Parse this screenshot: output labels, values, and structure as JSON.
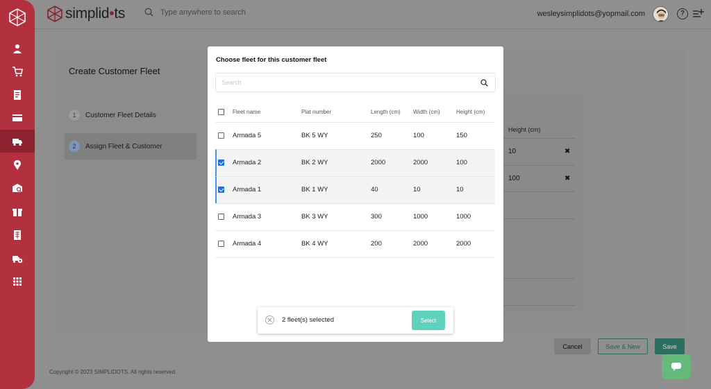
{
  "header": {
    "brand": "simplid",
    "brand_dot": "•",
    "brand_tail": "ts",
    "search_placeholder": "Type anywhere to search",
    "user_email": "wesleysimplidots@yopmail.com",
    "help_glyph": "?"
  },
  "sidebar": {
    "items": [
      {
        "icon": "user-icon"
      },
      {
        "icon": "cart-icon"
      },
      {
        "icon": "invoice-icon"
      },
      {
        "icon": "card-icon"
      },
      {
        "icon": "truck-icon",
        "active": true
      },
      {
        "icon": "location-pin-icon"
      },
      {
        "icon": "warehouse-search-icon"
      },
      {
        "icon": "gift-icon"
      },
      {
        "icon": "ledger-icon"
      },
      {
        "icon": "truck-settings-icon"
      },
      {
        "icon": "apps-grid-icon"
      }
    ]
  },
  "page": {
    "title": "Create Customer Fleet",
    "steps": [
      {
        "num": "1",
        "label": "Customer Fleet Details"
      },
      {
        "num": "2",
        "label": "Assign Fleet & Customer"
      }
    ],
    "bg_table": {
      "column": "Height (cm)",
      "rows": [
        "10",
        "100"
      ],
      "remove_glyph": "✖"
    },
    "buttons": {
      "cancel": "Cancel",
      "save_new": "Save & New",
      "save": "Save"
    },
    "copyright": "Copyright © 2023 SIMPLIDOTS. All rights reserved."
  },
  "modal": {
    "title": "Choose fleet for this customer fleet",
    "search_placeholder": "Search",
    "columns": [
      "Fleet name",
      "Plat number",
      "Length (cm)",
      "Width (cm)",
      "Height (cm)"
    ],
    "rows": [
      {
        "name": "Armada 5",
        "plat": "BK 5 WY",
        "length": "250",
        "width": "100",
        "height": "150",
        "checked": false
      },
      {
        "name": "Armada 2",
        "plat": "BK 2 WY",
        "length": "2000",
        "width": "2000",
        "height": "100",
        "checked": true
      },
      {
        "name": "Armada 1",
        "plat": "BK 1 WY",
        "length": "40",
        "width": "10",
        "height": "10",
        "checked": true
      },
      {
        "name": "Armada 3",
        "plat": "BK 3 WY",
        "length": "300",
        "width": "1000",
        "height": "1000",
        "checked": false
      },
      {
        "name": "Armada 4",
        "plat": "BK 4 WY",
        "length": "200",
        "width": "2000",
        "height": "2000",
        "checked": false
      }
    ]
  },
  "toast": {
    "text": "2 fleet(s) selected",
    "button": "Select"
  },
  "colors": {
    "sidebar": "#b3313f",
    "accent_teal": "#5fd2bd",
    "checkbox_blue": "#1f6fe0"
  }
}
